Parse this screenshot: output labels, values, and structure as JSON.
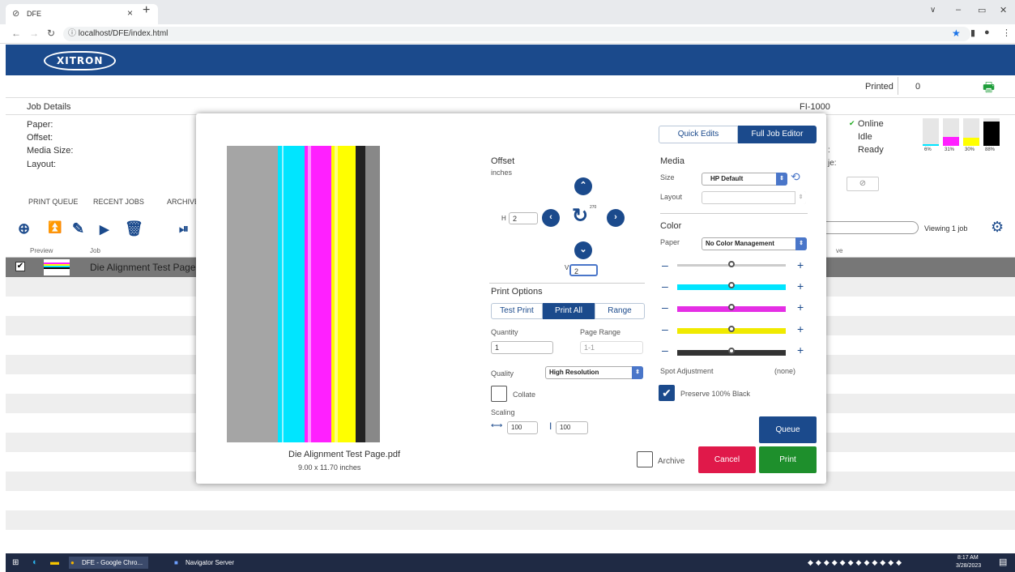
{
  "browser": {
    "tab_title": "DFE",
    "tab_close": "×",
    "new_tab": "+",
    "url": "localhost/DFE/index.html",
    "window_controls": [
      "∨",
      "–",
      "▭",
      "✕"
    ]
  },
  "app": {
    "logo": "XITRON",
    "printed_label": "Printed",
    "printed_count": "0",
    "job_details_label": "Job Details",
    "device_name": "FI-1000",
    "details_labels": [
      "Paper:",
      "Offset:",
      "Media Size:",
      "Layout:"
    ],
    "status": [
      "Online",
      "Idle",
      "Ready"
    ],
    "ink_levels": [
      {
        "color": "#00e5ff",
        "pct": 6,
        "label": "6%"
      },
      {
        "color": "#ff20ff",
        "pct": 31,
        "label": "31%"
      },
      {
        "color": "#ffff00",
        "pct": 30,
        "label": "30%"
      },
      {
        "color": "#000000",
        "pct": 88,
        "label": "88%"
      }
    ],
    "tabs": [
      "PRINT QUEUE",
      "RECENT JOBS",
      "ARCHIVE"
    ],
    "viewing": "Viewing 1 job",
    "columns": [
      "Preview",
      "Job"
    ],
    "column_tail": "ve",
    "row_job": "Die Alignment Test Page,"
  },
  "dialog": {
    "mode_tabs": [
      "Quick Edits",
      "Full Job Editor"
    ],
    "preview_filename": "Die Alignment Test Page.pdf",
    "preview_size": "9.00 x 11.70 inches",
    "offset_label": "Offset",
    "offset_units": "inches",
    "h_label": "H",
    "h_value": "2",
    "v_label": "V",
    "v_value": "2",
    "rotate_label": "270",
    "print_options_label": "Print Options",
    "print_modes": [
      "Test Print",
      "Print All",
      "Range"
    ],
    "quantity_label": "Quantity",
    "quantity_value": "1",
    "page_range_label": "Page Range",
    "page_range_value": "1-1",
    "quality_label": "Quality",
    "quality_value": "High Resolution",
    "collate_label": "Collate",
    "scaling_label": "Scaling",
    "scale_w": "100",
    "scale_h": "100",
    "media_label": "Media",
    "size_label": "Size",
    "size_value": "HP Default",
    "layout_label": "Layout",
    "color_label": "Color",
    "paper_label": "Paper",
    "paper_value": "No Color Management",
    "sliders": [
      {
        "name": "overall",
        "value": 0.5
      },
      {
        "name": "cyan",
        "value": 0.5
      },
      {
        "name": "magenta",
        "value": 0.5
      },
      {
        "name": "yellow",
        "value": 0.5
      },
      {
        "name": "black",
        "value": 0.5
      }
    ],
    "minus": "–",
    "plus": "+",
    "spot_label": "Spot Adjustment",
    "spot_value": "(none)",
    "preserve_black_label": "Preserve 100% Black",
    "archive_label": "Archive",
    "queue_button": "Queue",
    "cancel_button": "Cancel",
    "print_button": "Print"
  },
  "taskbar": {
    "items": [
      "DFE - Google Chro...",
      "Navigator Server"
    ],
    "time": "8:17 AM",
    "date": "3/28/2023"
  }
}
